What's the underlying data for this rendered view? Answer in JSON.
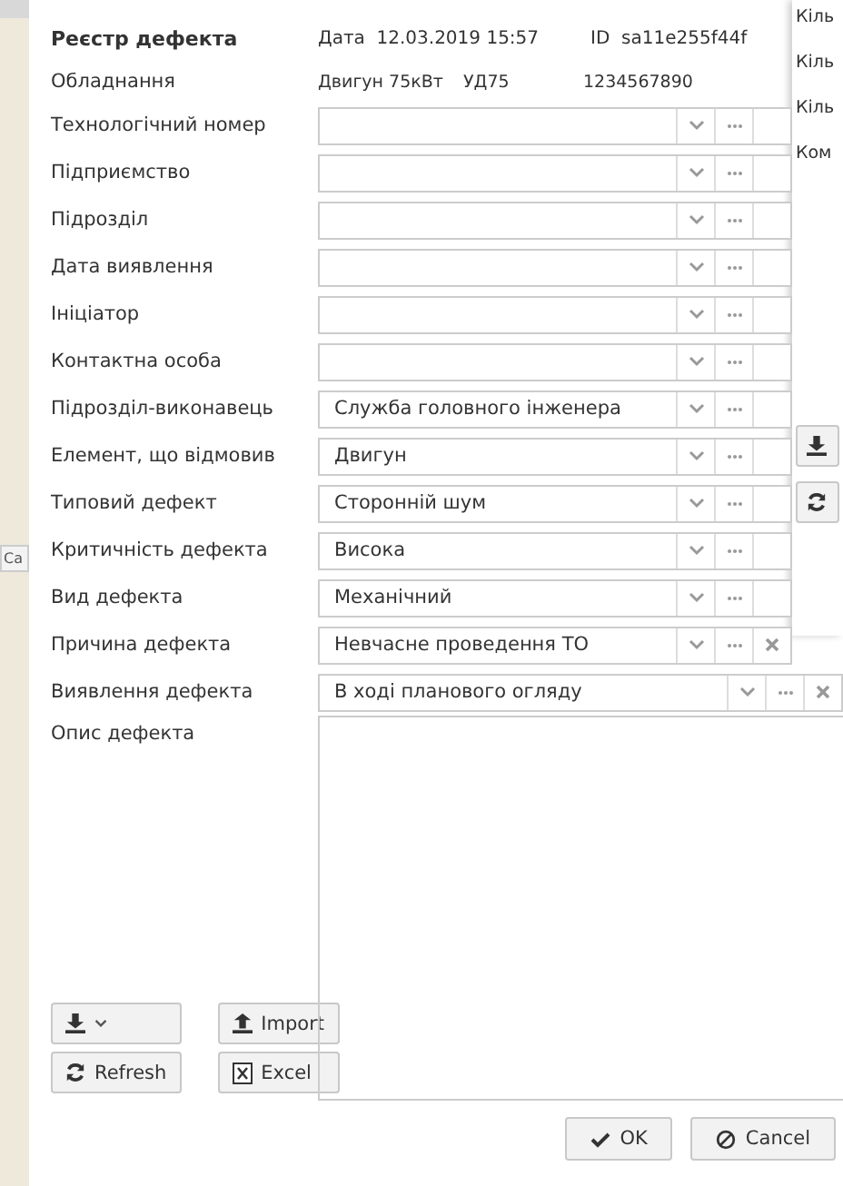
{
  "background": {
    "fragment": "Ca",
    "side_labels": [
      "Кіль",
      "Кіль",
      "Кіль",
      "Ком"
    ]
  },
  "dialog": {
    "title": "Реєстр дефекта",
    "date_label": "Дата",
    "date": "12.03.2019 15:57",
    "id_label": "ID",
    "id": "sa11e255f44f",
    "equipment": {
      "label": "Обладнання",
      "name": "Двигун 75кВт",
      "model": "УД75",
      "number": "1234567890"
    },
    "fields": [
      {
        "label": "Технологічний номер",
        "clearable": false
      },
      {
        "label": "Підприємство",
        "clearable": false
      },
      {
        "label": "Підрозділ",
        "clearable": false
      },
      {
        "label": "Дата виявлення",
        "clearable": false
      },
      {
        "label": "Ініціатор",
        "clearable": false
      },
      {
        "label": "Контактна особа",
        "clearable": false
      },
      {
        "label": "Підрозділ-виконавець",
        "value": "Служба головного інженера",
        "clearable": false
      },
      {
        "label": "Елемент, що відмовив",
        "value": "Двигун",
        "clearable": false
      },
      {
        "label": "Типовий дефект",
        "value": "Сторонній шум",
        "clearable": false
      },
      {
        "label": "Критичність дефекта",
        "value": "Висока",
        "clearable": false
      },
      {
        "label": "Вид дефекта",
        "value": "Механічний",
        "clearable": false
      },
      {
        "label": "Причина дефекта",
        "value": "Невчасне проведення ТО",
        "clearable": true
      },
      {
        "label": "Виявлення дефекта",
        "value": "В ході планового огляду",
        "clearable": true
      }
    ],
    "description_label": "Опис дефекта",
    "tools": [
      {
        "kind": "export"
      },
      {
        "kind": "import",
        "label": "Import"
      },
      {
        "kind": "refresh",
        "label": "Refresh"
      },
      {
        "kind": "excel",
        "label": "Excel"
      }
    ],
    "buttons": [
      {
        "kind": "ok",
        "label": "OK"
      },
      {
        "kind": "cancel",
        "label": "Cancel"
      }
    ]
  }
}
